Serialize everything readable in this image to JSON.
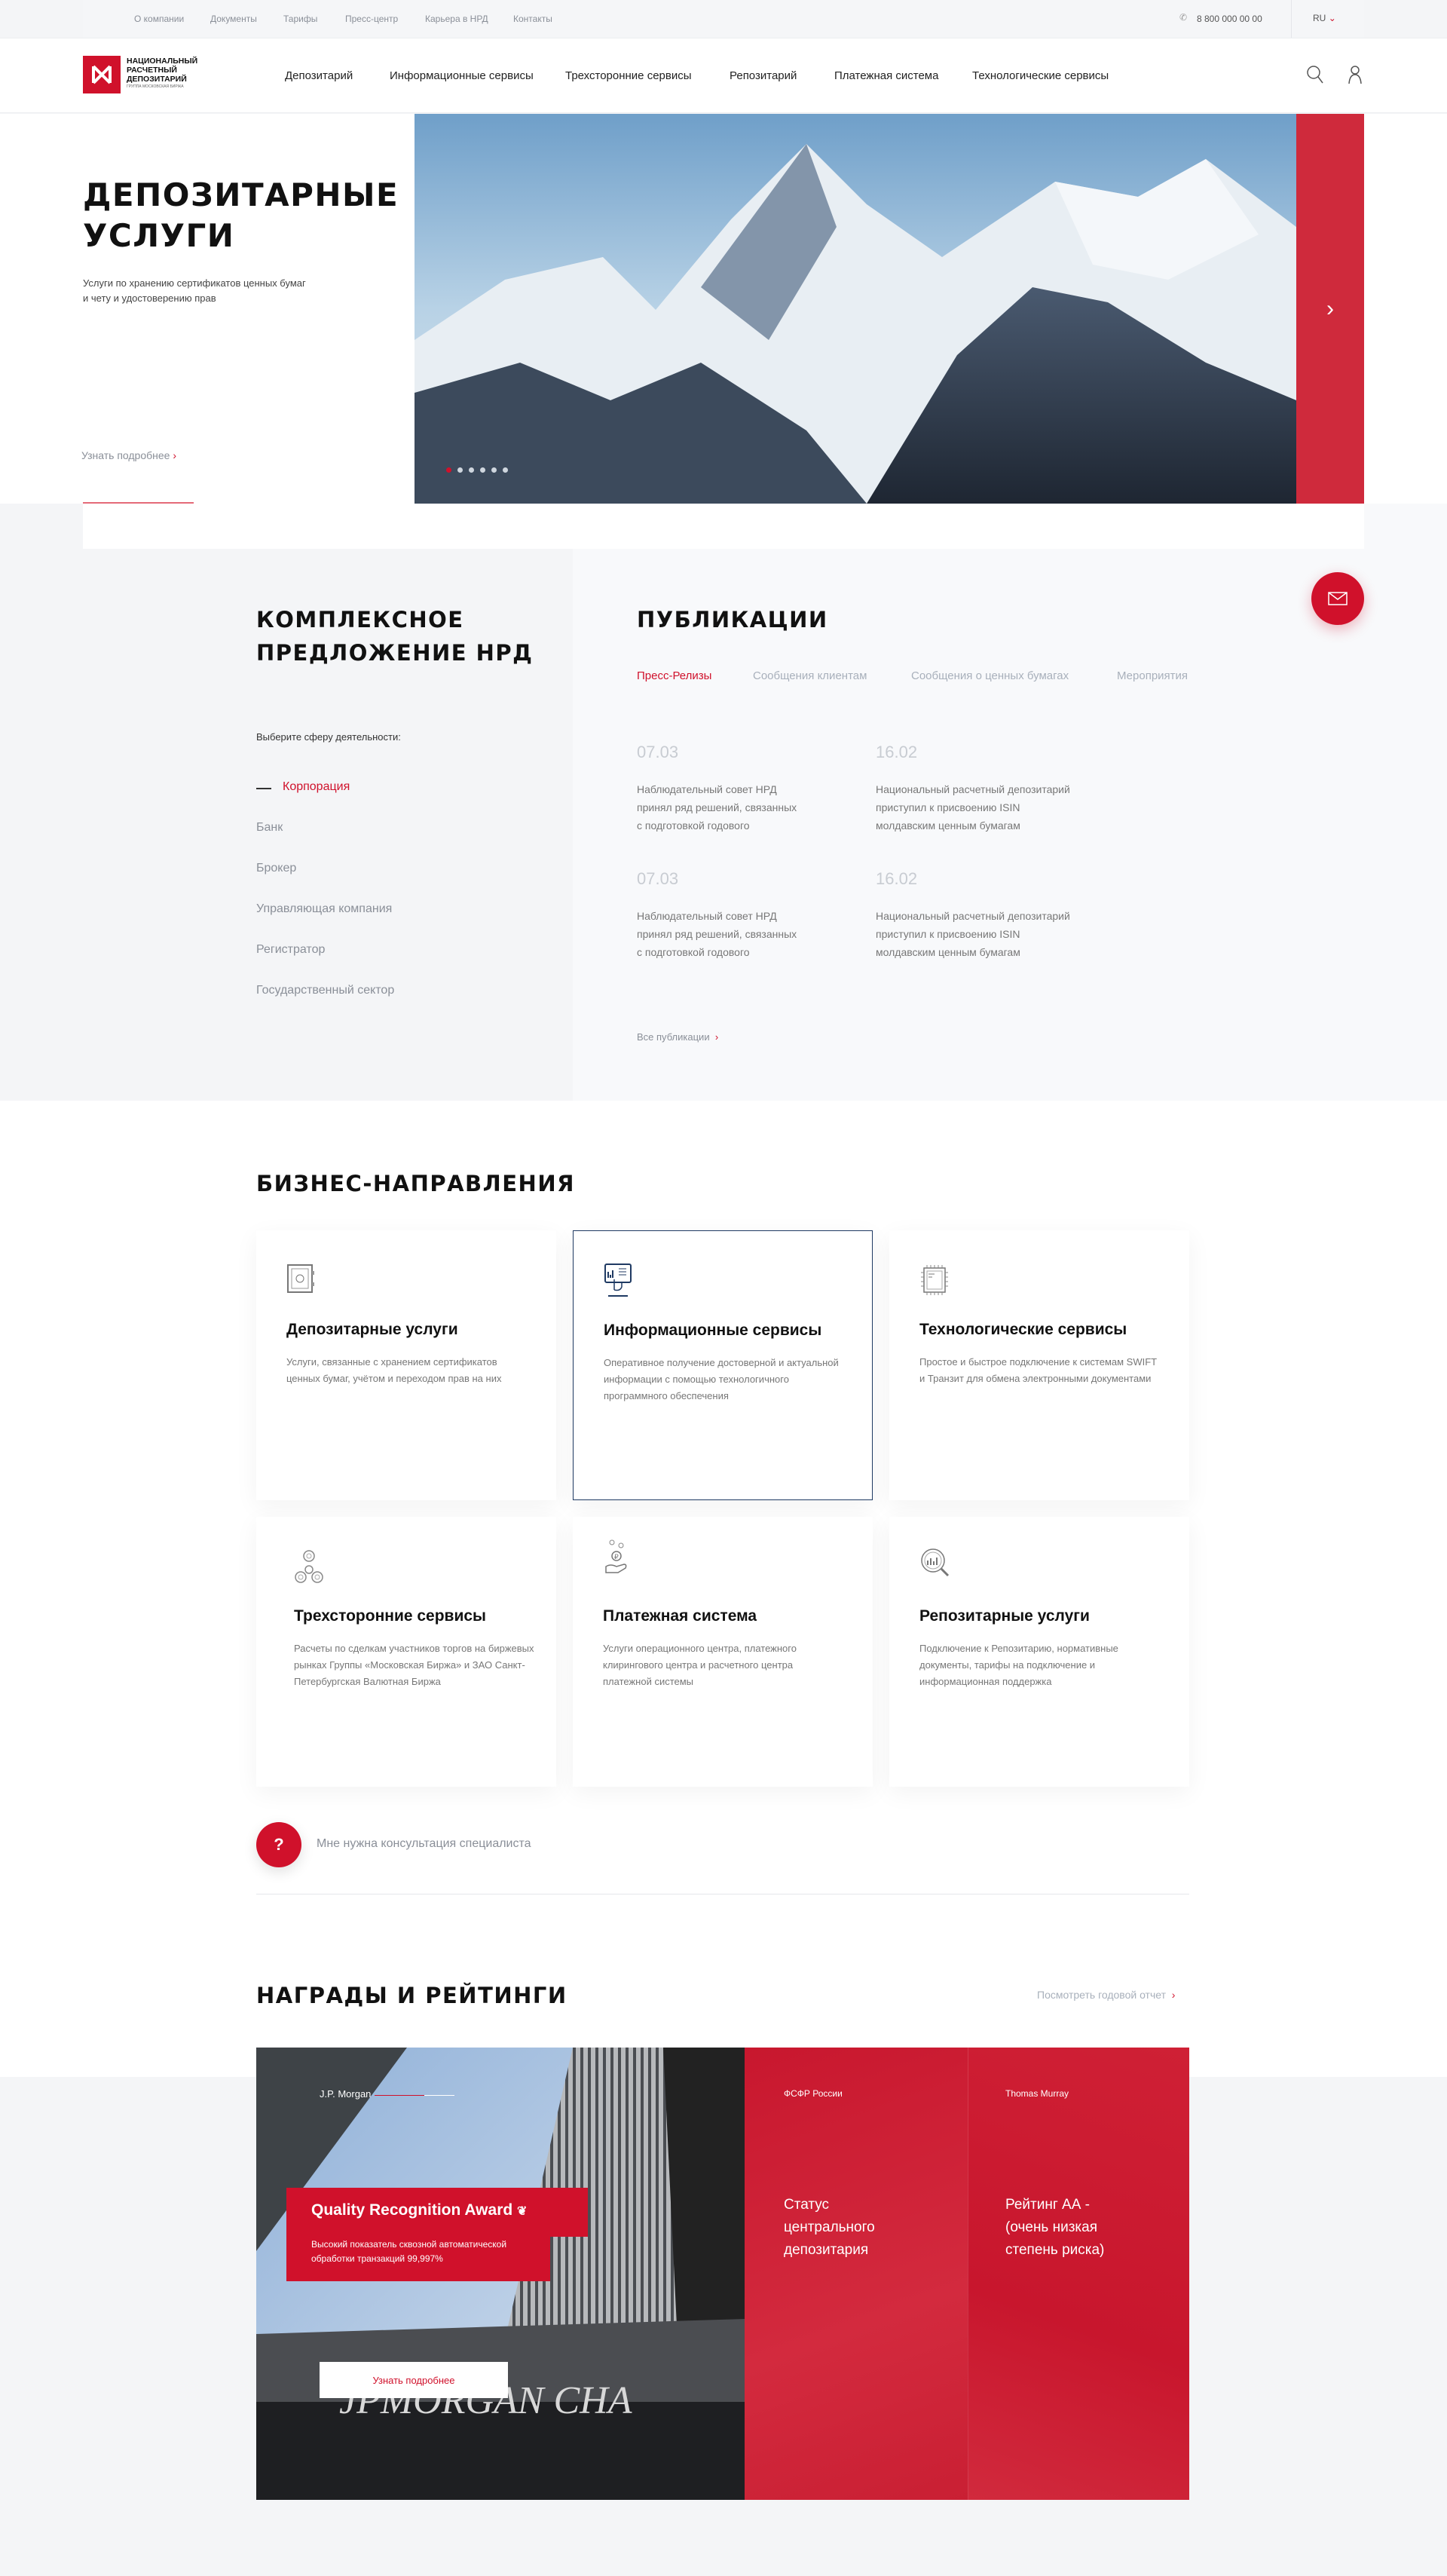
{
  "topbar": {
    "links": [
      "О компании",
      "Документы",
      "Тарифы",
      "Пресс-центр",
      "Карьера в НРД",
      "Контакты"
    ],
    "phone": "8 800 000 00 00",
    "lang": "RU"
  },
  "header": {
    "logo_text": [
      "НАЦИОНАЛЬНЫЙ",
      "РАСЧЕТНЫЙ",
      "ДЕПОЗИТАРИЙ"
    ],
    "logo_sub": "ГРУППА МОСКОВСКАЯ БИРЖА",
    "nav": [
      "Депозитарий",
      "Информационные сервисы",
      "Трехсторонние сервисы",
      "Репозитарий",
      "Платежная система",
      "Технологические сервисы"
    ]
  },
  "hero": {
    "title_1": "ДЕПОЗИТАРНЫЕ",
    "title_2": "УСЛУГИ",
    "subtitle_1": "Услуги по хранению сертификатов ценных бумаг",
    "subtitle_2": "и чету и удостоверению прав",
    "more": "Узнать подробнее",
    "slides": 6,
    "active_slide": 1
  },
  "offer": {
    "title_1": "КОМПЛЕКСНОЕ",
    "title_2": "ПРЕДЛОЖЕНИЕ НРД",
    "prompt": "Выберите сферу деятельности:",
    "items": [
      "Корпорация",
      "Банк",
      "Брокер",
      "Управляющая компания",
      "Регистратор",
      "Государственный сектор"
    ],
    "active": "Корпорация"
  },
  "publications": {
    "title": "ПУБЛИКАЦИИ",
    "tabs": [
      "Пресс-Релизы",
      "Сообщения клиентам",
      "Сообщения о ценных бумагах",
      "Мероприятия"
    ],
    "items": [
      {
        "date": "07.03",
        "lines": [
          "Наблюдательный совет НРД",
          "принял ряд решений, связанных",
          "с подготовкой годового"
        ]
      },
      {
        "date": "16.02",
        "lines": [
          "Национальный расчетный депозитарий",
          "приступил к присвоению ISIN",
          "молдавским ценным бумагам"
        ]
      },
      {
        "date": "07.03",
        "lines": [
          "Наблюдательный совет НРД",
          "принял ряд решений, связанных",
          "с подготовкой годового"
        ]
      },
      {
        "date": "16.02",
        "lines": [
          "Национальный расчетный депозитарий",
          "приступил к присвоению ISIN",
          "молдавским ценным бумагам"
        ]
      }
    ],
    "all": "Все публикации"
  },
  "business": {
    "title": "БИЗНЕС-НАПРАВЛЕНИЯ",
    "cards": [
      {
        "title": "Депозитарные услуги",
        "desc": "Услуги, связанные с хранением сертификатов ценных бумаг, учётом и переходом прав на них",
        "icon": "safe-icon"
      },
      {
        "title": "Информационные сервисы",
        "desc": "Оперативное получение достоверной и актуальной информации с помощью технологичного программного обеспечения",
        "icon": "touch-screen-icon"
      },
      {
        "title": "Технологические сервисы",
        "desc": "Простое и быстрое подключение к системам SWIFT и Транзит для обмена электронными документами",
        "icon": "chip-icon"
      },
      {
        "title": "Трехсторонние сервисы",
        "desc": "Расчеты по сделкам участников торгов на биржевых рынках Группы «Московская Биржа» и ЗАО Санкт-Петербургская Валютная Биржа",
        "icon": "spinner-icon"
      },
      {
        "title": "Платежная система",
        "desc": "Услуги операционного центра, платежного клирингового центра и расчетного центра платежной системы",
        "icon": "coin-hand-icon"
      },
      {
        "title": "Репозитарные услуги",
        "desc": "Подключение к Репозитарию, нормативные документы, тарифы на подключение и информационная поддержка",
        "icon": "magnifier-chart-icon"
      }
    ],
    "consult": "Мне нужна консультация специалиста"
  },
  "awards": {
    "title": "НАГРАДЫ И РЕЙТИНГИ",
    "report": "Посмотреть годовой отчет",
    "jp": {
      "source": "J.P. Morgan",
      "title": "Quality Recognition Award",
      "desc_1": "Высокий показатель сквозной автоматической",
      "desc_2": "обработки транзакций 99,997%",
      "button": "Узнать подробнее",
      "sign": "JPMORGAN CHA"
    },
    "fsfr": {
      "source": "ФСФР России",
      "lines": [
        "Статус",
        "центрального",
        "депозитария"
      ]
    },
    "tm": {
      "source": "Thomas Murray",
      "lines": [
        "Рейтинг АА -",
        "(очень низкая",
        "степень риска)"
      ]
    }
  },
  "colors": {
    "accent": "#d0112b",
    "dark": "#111111",
    "muted": "#8a8f98",
    "navy": "#1f3a63"
  }
}
